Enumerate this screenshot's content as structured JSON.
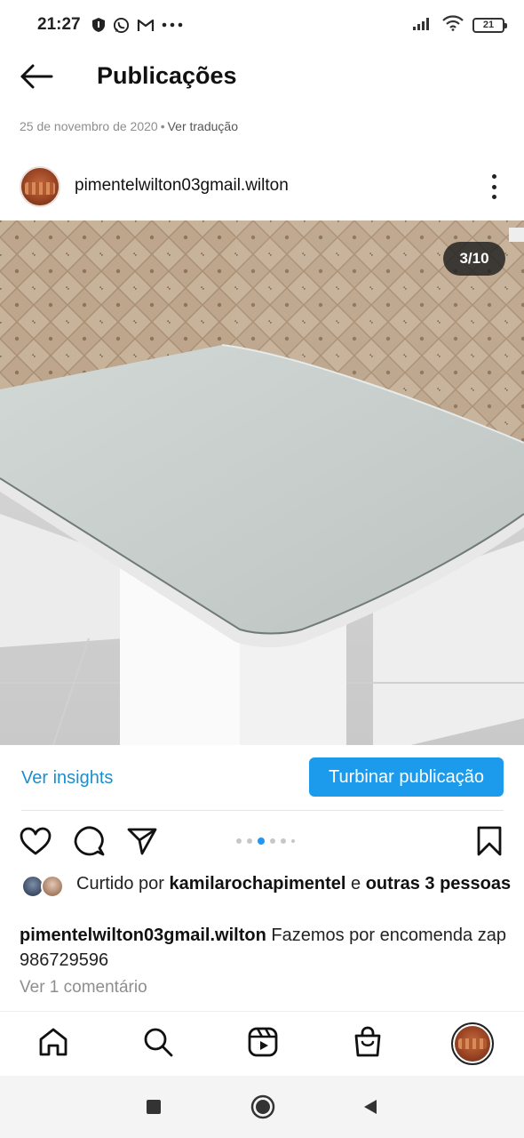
{
  "status_bar": {
    "time": "21:27",
    "battery_level": "21",
    "left_icons": [
      "shield-icon",
      "whatsapp-icon",
      "gmail-icon",
      "more-dots-icon"
    ],
    "right_icons": [
      "signal-icon",
      "wifi-icon",
      "battery-icon"
    ]
  },
  "header": {
    "title": "Publicações",
    "back_icon": "arrow-left-icon"
  },
  "post": {
    "date": "25 de novembro de 2020",
    "separator": "•",
    "translate_label": "Ver tradução",
    "author": "pimentelwilton03gmail.wilton",
    "slide_counter": "3/10",
    "current_slide": 3,
    "total_slides": 10
  },
  "insights": {
    "link_label": "Ver insights",
    "boost_label": "Turbinar publicação"
  },
  "actions": {
    "icons": [
      "heart-icon",
      "comment-icon",
      "share-icon",
      "bookmark-icon"
    ],
    "dots_active_index": 2
  },
  "likes": {
    "prefix": "Curtido por ",
    "user": "kamilarochapimentel",
    "conjunction": " e ",
    "others": "outras 3 pessoas"
  },
  "caption": {
    "author": "pimentelwilton03gmail.wilton",
    "text": " Fazemos por encomenda zap 986729596"
  },
  "comments": {
    "link_label": "Ver 1 comentário"
  },
  "bottom_nav": {
    "items": [
      "home-icon",
      "search-icon",
      "reels-icon",
      "shop-icon",
      "profile-avatar"
    ]
  },
  "system_nav": {
    "items": [
      "recents-icon",
      "home-circle-icon",
      "back-triangle-icon"
    ]
  },
  "colors": {
    "accent": "#1c9aeb",
    "link": "#1a8fcf",
    "muted": "#8e8e8e"
  }
}
